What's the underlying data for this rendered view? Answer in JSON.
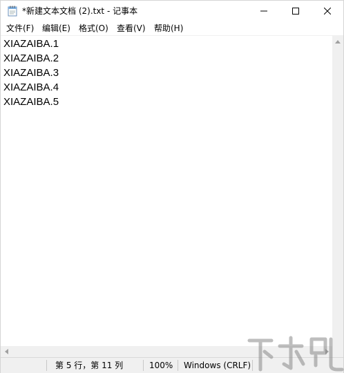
{
  "window": {
    "title": "*新建文本文档 (2).txt - 记事本"
  },
  "menu": {
    "items": [
      {
        "label": "文件(F)"
      },
      {
        "label": "编辑(E)"
      },
      {
        "label": "格式(O)"
      },
      {
        "label": "查看(V)"
      },
      {
        "label": "帮助(H)"
      }
    ]
  },
  "editor": {
    "lines": [
      "XIAZAIBA.1",
      "XIAZAIBA.2",
      "XIAZAIBA.3",
      "XIAZAIBA.4",
      "XIAZAIBA.5"
    ]
  },
  "status": {
    "position": "第 5 行，第 11 列",
    "zoom": "100%",
    "line_ending": "Windows (CRLF)"
  },
  "icons": {
    "app": "notepad-icon",
    "minimize": "minimize-icon",
    "maximize": "maximize-icon",
    "close": "close-icon"
  },
  "colors": {
    "chrome": "#f0f0f0",
    "text": "#000000"
  }
}
